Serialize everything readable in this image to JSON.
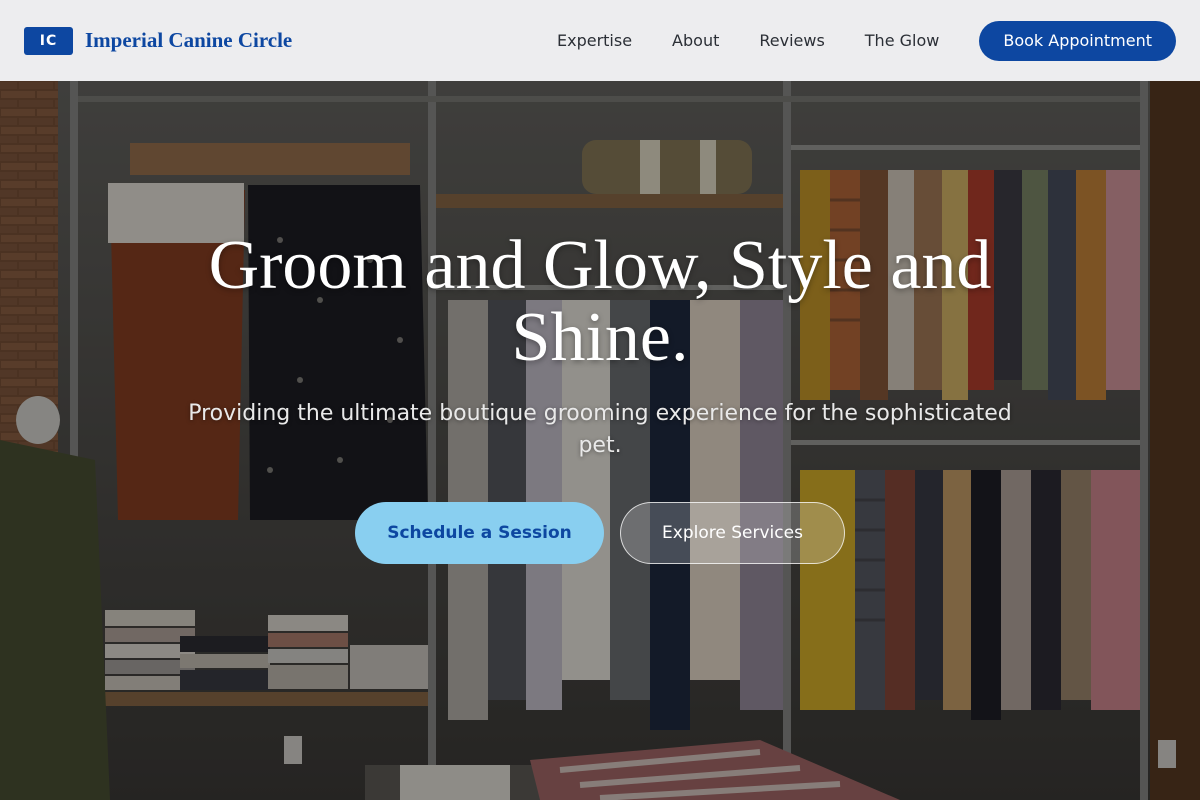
{
  "header": {
    "badge": "IC",
    "brand": "Imperial Canine Circle",
    "nav": [
      {
        "label": "Expertise"
      },
      {
        "label": "About"
      },
      {
        "label": "Reviews"
      },
      {
        "label": "The Glow"
      }
    ],
    "book_label": "Book Appointment"
  },
  "hero": {
    "title": "Groom and Glow, Style and Shine.",
    "subtitle": "Providing the ultimate boutique grooming experience for the sophisticated pet.",
    "primary_cta": "Schedule a Session",
    "secondary_cta": "Explore Services",
    "background": "boutique-clothing-rack-photo"
  },
  "colors": {
    "brand_blue": "#0d47a1",
    "cta_light_blue": "#89cff0",
    "header_bg": "#f5f5f7"
  }
}
